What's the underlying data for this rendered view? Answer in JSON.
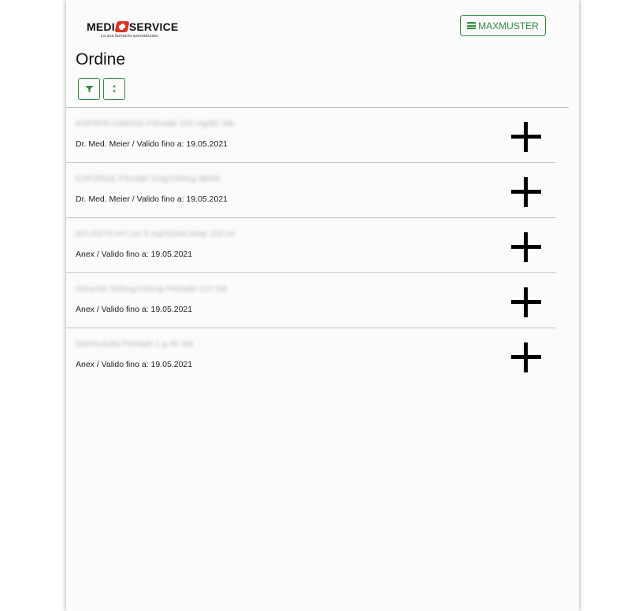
{
  "brand": {
    "name_left": "MEDI",
    "name_right": "SERVICE",
    "tagline": "La sua farmacia specializzata",
    "cross_color": "#e0301e"
  },
  "header": {
    "menu_label": "MAXMUSTER",
    "accent_color": "#2e8b3e"
  },
  "page": {
    "title": "Ordine"
  },
  "toolbar": {
    "filter_icon": "funnel-icon",
    "sort_icon": "sort-arrows-icon"
  },
  "orders": [
    {
      "name": "ASPIRIN CARDIO Filmtabl 100 mg/80 Stk",
      "subtitle": "Dr. Med. Meier / Valido fino a: 19.05.2021",
      "action_icon": "plus-icon"
    },
    {
      "name": "EXFORGE Filmtabl 5mg/160mg 98Stk",
      "subtitle": "Dr. Med. Meier / Valido fino a: 19.05.2021",
      "action_icon": "plus-icon"
    },
    {
      "name": "ACLASTA Inf Lös 5 mg/100ml Amp 100 ml",
      "subtitle": "Anex / Valido fino a: 19.05.2021",
      "action_icon": "plus-icon"
    },
    {
      "name": "Orkambi 200mg/125mg Filmtabl 112 Stk",
      "subtitle": "Anex / Valido fino a: 19.05.2021",
      "action_icon": "plus-icon"
    },
    {
      "name": "DAFALGAN Filmtabl 1 g 40 Stk",
      "subtitle": "Anex / Valido fino a: 19.05.2021",
      "action_icon": "plus-icon"
    }
  ]
}
